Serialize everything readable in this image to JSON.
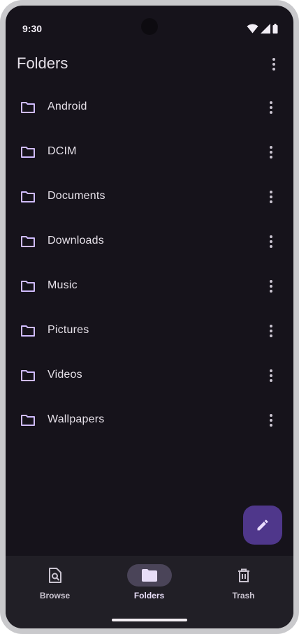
{
  "status_bar": {
    "time": "9:30"
  },
  "top_bar": {
    "title": "Folders"
  },
  "folders": [
    {
      "label": "Android"
    },
    {
      "label": "DCIM"
    },
    {
      "label": "Documents"
    },
    {
      "label": "Downloads"
    },
    {
      "label": "Music"
    },
    {
      "label": "Pictures"
    },
    {
      "label": "Videos"
    },
    {
      "label": "Wallpapers"
    }
  ],
  "fab": {
    "icon": "edit-icon"
  },
  "bottom_nav": {
    "items": [
      {
        "label": "Browse",
        "icon": "browse-icon",
        "selected": false
      },
      {
        "label": "Folders",
        "icon": "folder-icon",
        "selected": true
      },
      {
        "label": "Trash",
        "icon": "trash-icon",
        "selected": false
      }
    ]
  },
  "colors": {
    "background": "#16131b",
    "accent": "#d0bcff",
    "fab": "#4f378b",
    "nav_background": "#211f26",
    "nav_active_pill": "#4a4458"
  }
}
